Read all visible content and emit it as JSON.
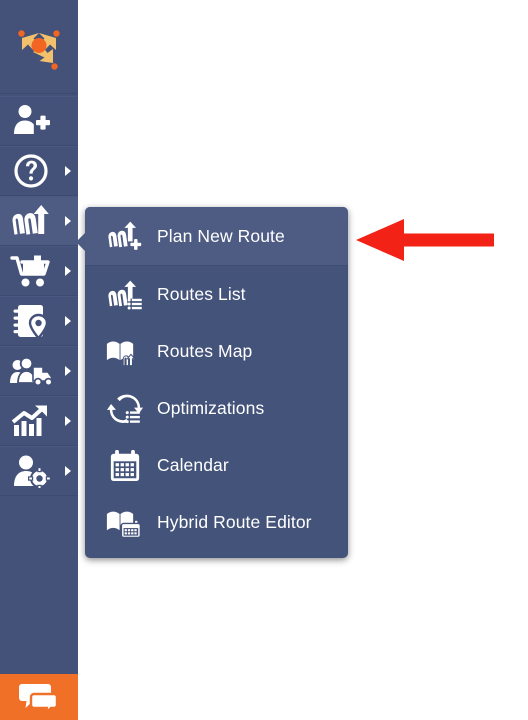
{
  "app": {
    "brand_logo_name": "route4me-logo",
    "sidebar_bg": "#44527a",
    "panel_bg": "#44537a",
    "highlight_bg": "#4e5c84",
    "accent_orange": "#f07028",
    "logo_orange": "#f26522",
    "logo_tan": "#f3c16c",
    "annotation_red": "#f22216",
    "text_color": "#ffffff"
  },
  "sidebar": {
    "items": [
      {
        "icon": "add-user-icon",
        "label": "Add User",
        "has_chevron": false,
        "active": false
      },
      {
        "icon": "help-question-icon",
        "label": "Help",
        "has_chevron": true,
        "active": false
      },
      {
        "icon": "routes-icon",
        "label": "Routes",
        "has_chevron": true,
        "active": true
      },
      {
        "icon": "shopping-cart-icon",
        "label": "Orders",
        "has_chevron": true,
        "active": false
      },
      {
        "icon": "address-book-icon",
        "label": "Address Book",
        "has_chevron": true,
        "active": false
      },
      {
        "icon": "team-truck-icon",
        "label": "Team",
        "has_chevron": true,
        "active": false
      },
      {
        "icon": "analytics-icon",
        "label": "Analytics",
        "has_chevron": true,
        "active": false
      },
      {
        "icon": "user-settings-icon",
        "label": "User Settings",
        "has_chevron": true,
        "active": false
      }
    ],
    "chat": {
      "icon": "chat-bubbles-icon",
      "label": "Support Chat"
    }
  },
  "flyout": {
    "name": "routes-menu",
    "items": [
      {
        "icon": "plan-new-route-icon",
        "label": "Plan New Route",
        "selected": true
      },
      {
        "icon": "routes-list-icon",
        "label": "Routes List",
        "selected": false
      },
      {
        "icon": "routes-map-icon",
        "label": "Routes Map",
        "selected": false
      },
      {
        "icon": "optimizations-icon",
        "label": "Optimizations",
        "selected": false
      },
      {
        "icon": "calendar-icon",
        "label": "Calendar",
        "selected": false
      },
      {
        "icon": "hybrid-route-editor-icon",
        "label": "Hybrid Route Editor",
        "selected": false
      }
    ]
  },
  "annotation": {
    "name": "red-pointer-arrow",
    "points_to": "Plan New Route",
    "direction": "left",
    "color": "#f22216"
  }
}
